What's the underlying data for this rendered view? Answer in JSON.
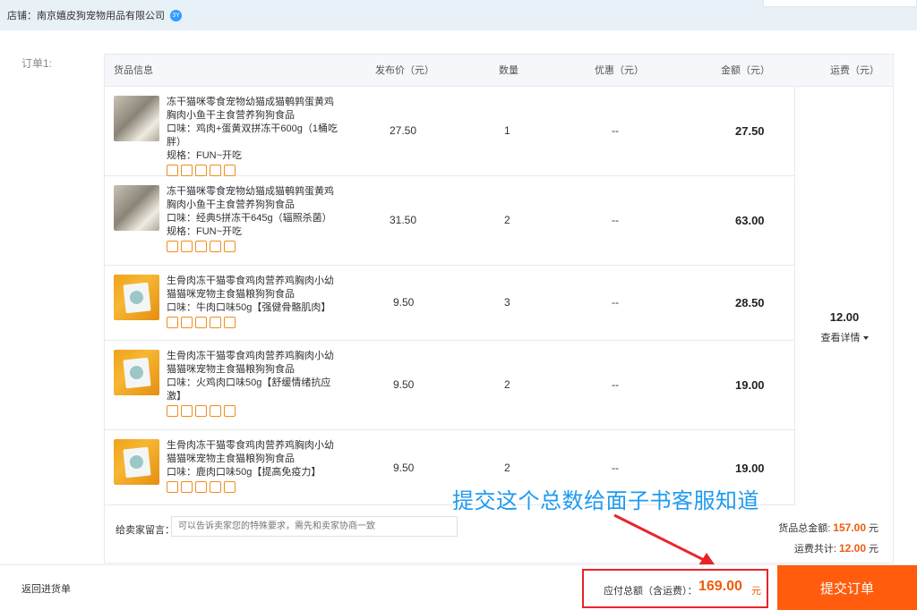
{
  "shop": {
    "label": "店铺：",
    "name": "南京嬉皮狗宠物用品有限公司",
    "badge": "3Y"
  },
  "order": {
    "label": "订单1:",
    "headers": {
      "goods": "货品信息",
      "price": "发布价（元）",
      "qty": "数量",
      "discount": "优惠（元）",
      "amount": "金额（元）",
      "shipping": "运费（元）"
    },
    "items": [
      {
        "title": "冻干猫咪零食宠物幼猫成猫鹌鹑蛋黄鸡胸肉小鱼干主食营养狗狗食品",
        "spec1": "口味：鸡肉+蛋黄双拼冻干600g（1桶吃胖）",
        "spec2": "规格：FUN~开吃",
        "price": "27.50",
        "qty": "1",
        "discount": "--",
        "amount": "27.50"
      },
      {
        "title": "冻干猫咪零食宠物幼猫成猫鹌鹑蛋黄鸡胸肉小鱼干主食营养狗狗食品",
        "spec1": "口味：经典5拼冻干645g（辐照杀菌）",
        "spec2": "规格：FUN~开吃",
        "price": "31.50",
        "qty": "2",
        "discount": "--",
        "amount": "63.00"
      },
      {
        "title": "生骨肉冻干猫零食鸡肉营养鸡胸肉小幼猫猫咪宠物主食猫粮狗狗食品",
        "spec1": "口味：牛肉口味50g【强健骨骼肌肉】",
        "spec2": "",
        "price": "9.50",
        "qty": "3",
        "discount": "--",
        "amount": "28.50"
      },
      {
        "title": "生骨肉冻干猫零食鸡肉营养鸡胸肉小幼猫猫咪宠物主食猫粮狗狗食品",
        "spec1": "口味：火鸡肉口味50g【舒缓情绪抗应激】",
        "spec2": "",
        "price": "9.50",
        "qty": "2",
        "discount": "--",
        "amount": "19.00"
      },
      {
        "title": "生骨肉冻干猫零食鸡肉营养鸡胸肉小幼猫猫咪宠物主食猫粮狗狗食品",
        "spec1": "口味：鹿肉口味50g【提高免疫力】",
        "spec2": "",
        "price": "9.50",
        "qty": "2",
        "discount": "--",
        "amount": "19.00"
      }
    ],
    "shipping": {
      "value": "12.00",
      "detail_link": "查看详情"
    },
    "remark": {
      "label": "给卖家留言：",
      "placeholder": "可以告诉卖家您的特殊要求，需先和卖家协商一致"
    },
    "summary": {
      "goods_total_label": "货品总金额:",
      "goods_total": "157.00",
      "shipping_total_label": "运费共计:",
      "shipping_total": "12.00",
      "unit": "元"
    }
  },
  "annotation": "提交这个总数给面子书客服知道",
  "footer": {
    "back_link": "返回进货单",
    "total_label": "应付总额（含运费）：",
    "total_value": "169.00",
    "total_unit": "元",
    "submit_label": "提交订单"
  },
  "colors": {
    "accent": "#ff5d0d",
    "price_orange": "#f05b0a",
    "annotation_blue": "#1e9af0",
    "highlight_red": "#e8242a"
  }
}
